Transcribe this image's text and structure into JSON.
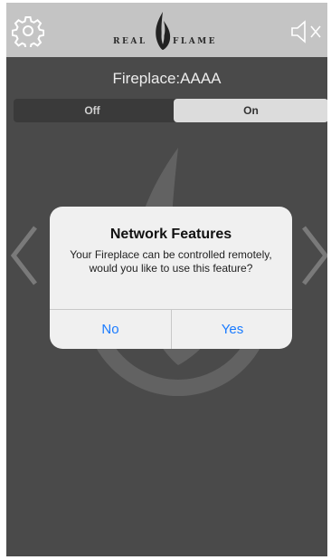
{
  "header": {
    "logo_left": "REAL",
    "logo_right": "FLAME",
    "settings_icon": "gear-icon",
    "mute_icon": "speaker-muted-icon"
  },
  "device": {
    "title": "Fireplace:AAAA"
  },
  "power_switch": {
    "off_label": "Off",
    "on_label": "On",
    "selected": "On"
  },
  "navigation": {
    "prev_icon": "chevron-left-icon",
    "next_icon": "chevron-right-icon"
  },
  "dialog": {
    "title": "Network Features",
    "message": "Your Fireplace can be controlled remotely, would you like to use this feature?",
    "no_label": "No",
    "yes_label": "Yes"
  },
  "colors": {
    "background": "#4a4a4a",
    "header": "#c4c4c4",
    "accent": "#1a7bff"
  }
}
